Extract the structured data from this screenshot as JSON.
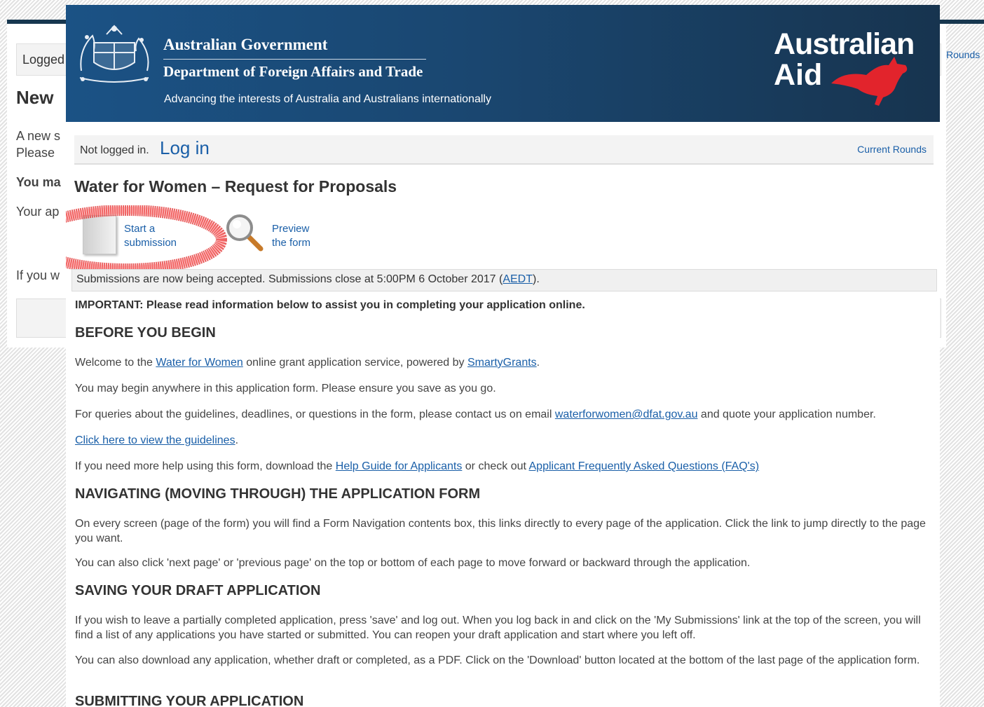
{
  "background_page": {
    "login_text": "Logged",
    "rounds_link": "Rounds",
    "heading": "New",
    "line1": "A new s",
    "line2": "Please",
    "line3": "You ma",
    "line4": "Your ap",
    "line5": "If you w"
  },
  "header": {
    "gov_title": "Australian Government",
    "department": "Department of Foreign Affairs and Trade",
    "tagline": "Advancing the interests of Australia and Australians internationally",
    "aid_word1": "Australian",
    "aid_word2": "Aid",
    "crest_icon": "coat-of-arms-icon",
    "kangaroo_icon": "kangaroo-icon",
    "kangaroo_color": "#e2242c",
    "header_color": "#1a4771"
  },
  "loginbar": {
    "not_logged": "Not logged in.",
    "login_link": "Log in",
    "current_rounds": "Current Rounds"
  },
  "page": {
    "title": "Water for Women – Request for Proposals"
  },
  "actions": {
    "start": "Start a submission",
    "preview": "Preview the form",
    "start_icon": "document-icon",
    "preview_icon": "magnifier-icon",
    "highlight_color": "#e53a3a"
  },
  "status": {
    "text_before": "Submissions are now being accepted. Submissions close at 5:00PM 6 October 2017 (",
    "tz_link": "AEDT",
    "text_after": ")."
  },
  "content": {
    "important": "IMPORTANT: Please read information below to assist you in completing your application online.",
    "h_before": "BEFORE YOU BEGIN",
    "welcome_a": "Welcome to the ",
    "welcome_link1": "Water for Women",
    "welcome_b": " online grant application service, powered by ",
    "welcome_link2": "SmartyGrants",
    "welcome_c": ".",
    "p_begin": "You may begin anywhere in this application form. Please ensure you save as you go.",
    "queries_a": "For queries about the guidelines, deadlines, or questions in the form, please contact us on email ",
    "queries_link": "waterforwomen@dfat.gov.au",
    "queries_b": " and quote your application number.",
    "guidelines_link": "Click here to view the guidelines",
    "guidelines_after": ".",
    "help_a": "If you need more help using this form, download the ",
    "help_link1": "Help Guide for Applicants",
    "help_b": " or check out ",
    "help_link2": "Applicant Frequently Asked Questions (FAQ's)",
    "h_nav": "NAVIGATING (MOVING THROUGH) THE APPLICATION FORM",
    "p_nav1": "On every screen (page of the form) you will find a Form Navigation contents box, this links directly to every page of the application. Click the link to jump directly to the page you want.",
    "p_nav2": "You can also click 'next page' or 'previous page' on the top or bottom of each page to move forward or backward through the application.",
    "h_save": "SAVING YOUR DRAFT APPLICATION",
    "p_save1": "If you wish to leave a partially completed application, press 'save' and log out. When you log back in and click on the 'My Submissions' link at the top of the screen, you will find a list of any applications you have started or submitted. You can reopen your draft application and start where you left off.",
    "p_save2": "You can also download any application, whether draft or completed, as a PDF. Click on the 'Download' button located at the bottom of the last page of the application form.",
    "h_submit": "SUBMITTING YOUR APPLICATION"
  }
}
